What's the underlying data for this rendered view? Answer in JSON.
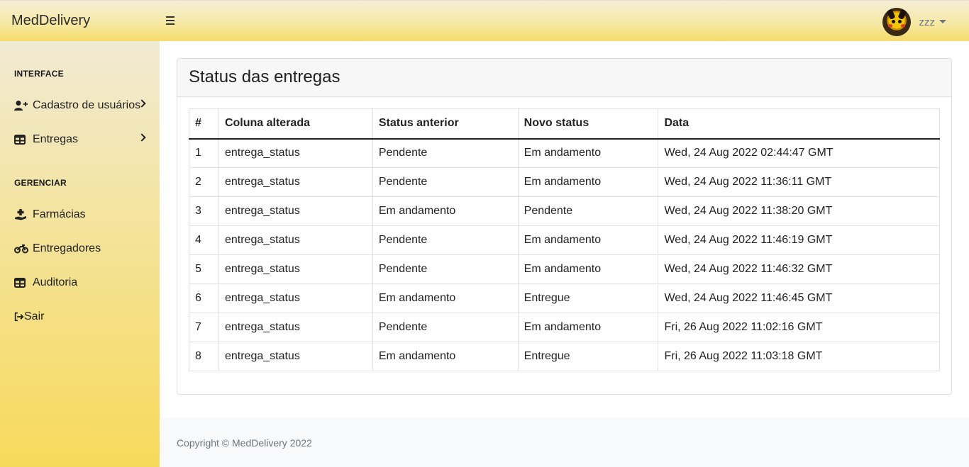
{
  "topbar": {
    "brand": "MedDelivery",
    "user": {
      "name": "zzz",
      "avatar_icon": "avatar-icon"
    }
  },
  "sidebar": {
    "heading_interface": "INTERFACE",
    "heading_gerenciar": "GERENCIAR",
    "items": [
      {
        "label": "Cadastro de usuários",
        "icon": "user-plus-icon"
      },
      {
        "label": "Entregas",
        "icon": "table-icon"
      },
      {
        "label": "Farmácias",
        "icon": "hand-holding-medical-icon"
      },
      {
        "label": "Entregadores",
        "icon": "motorcycle-icon"
      },
      {
        "label": "Auditoria",
        "icon": "table-icon"
      },
      {
        "label": "Sair",
        "icon": "sign-out-icon"
      }
    ]
  },
  "main": {
    "title": "Status das entregas",
    "table": {
      "headers": [
        "#",
        "Coluna alterada",
        "Status anterior",
        "Novo status",
        "Data"
      ],
      "rows": [
        [
          "1",
          "entrega_status",
          "Pendente",
          "Em andamento",
          "Wed, 24 Aug 2022 02:44:47 GMT"
        ],
        [
          "2",
          "entrega_status",
          "Pendente",
          "Em andamento",
          "Wed, 24 Aug 2022 11:36:11 GMT"
        ],
        [
          "3",
          "entrega_status",
          "Em andamento",
          "Pendente",
          "Wed, 24 Aug 2022 11:38:20 GMT"
        ],
        [
          "4",
          "entrega_status",
          "Pendente",
          "Em andamento",
          "Wed, 24 Aug 2022 11:46:19 GMT"
        ],
        [
          "5",
          "entrega_status",
          "Pendente",
          "Em andamento",
          "Wed, 24 Aug 2022 11:46:32 GMT"
        ],
        [
          "6",
          "entrega_status",
          "Em andamento",
          "Entregue",
          "Wed, 24 Aug 2022 11:46:45 GMT"
        ],
        [
          "7",
          "entrega_status",
          "Pendente",
          "Em andamento",
          "Fri, 26 Aug 2022 11:02:16 GMT"
        ],
        [
          "8",
          "entrega_status",
          "Em andamento",
          "Entregue",
          "Fri, 26 Aug 2022 11:03:18 GMT"
        ]
      ]
    }
  },
  "footer": {
    "copyright": "Copyright © MedDelivery 2022"
  },
  "colors": {
    "sidebar_top": "#f1ead4",
    "sidebar_bottom": "#f7d95a",
    "topbar_bottom": "#f6dc6a"
  }
}
